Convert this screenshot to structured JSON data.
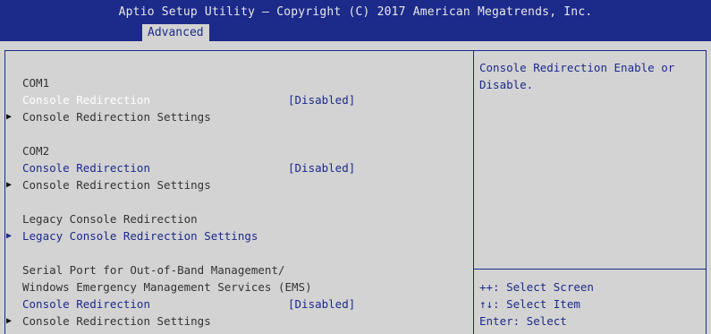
{
  "header": {
    "title": "Aptio Setup Utility – Copyright (C) 2017 American Megatrends, Inc.",
    "active_tab": "Advanced"
  },
  "settings": {
    "com1": {
      "heading": "COM1",
      "redirection_label": "Console Redirection",
      "redirection_value": "[Disabled]",
      "settings_label": "Console Redirection Settings"
    },
    "com2": {
      "heading": "COM2",
      "redirection_label": "Console Redirection",
      "redirection_value": "[Disabled]",
      "settings_label": "Console Redirection Settings"
    },
    "legacy": {
      "heading": "Legacy Console Redirection",
      "settings_label": "Legacy Console Redirection Settings"
    },
    "ems": {
      "heading_line1": "Serial Port for Out-of-Band Management/",
      "heading_line2": "Windows Emergency Management Services (EMS)",
      "redirection_label": "Console Redirection",
      "redirection_value": "[Disabled]",
      "settings_label": "Console Redirection Settings"
    }
  },
  "help": {
    "description_line1": "Console Redirection Enable or",
    "description_line2": "Disable.",
    "keys": [
      "++: Select Screen",
      "↑↓: Select Item",
      "Enter: Select"
    ]
  },
  "colors": {
    "header_bg": "#1c2a8a",
    "body_bg": "#d3d3d3",
    "highlight": "#ffffff",
    "link": "#1c2a8a"
  }
}
